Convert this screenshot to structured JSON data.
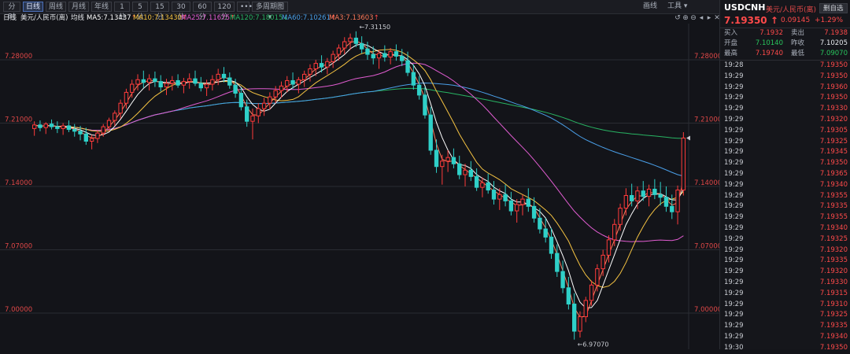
{
  "toolbar": {
    "tabs": [
      "分时",
      "日线",
      "周线",
      "月线",
      "年线",
      "1分",
      "5分",
      "15分",
      "30分",
      "60分",
      "120分",
      "•••",
      "多周期图"
    ],
    "active_index": 1,
    "right_items": [
      "画线",
      "工具"
    ],
    "panel_button": "删自选"
  },
  "ma_bar": {
    "period": "日线",
    "instrument": "美元/人民币(离)",
    "type": "均线",
    "items": [
      {
        "label": "MA5:7.13437",
        "arrow": "↑",
        "color": "#ffffff"
      },
      {
        "label": "MA10:7.13430",
        "arrow": "↑",
        "color": "#f5c342"
      },
      {
        "label": "MA25:7.11675",
        "arrow": "↑",
        "color": "#e05cd0"
      },
      {
        "label": "MA120:7.18015",
        "arrow": "↓",
        "color": "#28b463"
      },
      {
        "label": "MA60:7.10261",
        "arrow": "↑",
        "color": "#4a9fe8"
      },
      {
        "label": "MA3:7.13603",
        "arrow": "↑",
        "color": "#ff7c5c"
      }
    ]
  },
  "chart_data": {
    "type": "candlestick",
    "y_ticks": [
      "7.28000",
      "7.21000",
      "7.14000",
      "7.07000",
      "7.00000"
    ],
    "ylim": [
      6.96,
      7.32
    ],
    "annotations": [
      {
        "label": "←7.31150",
        "value": 7.3115
      },
      {
        "label": "←6.97070",
        "value": 6.9707
      }
    ],
    "current_price": 7.1935,
    "ohlc": [
      [
        7.204,
        7.212,
        7.196,
        7.208
      ],
      [
        7.208,
        7.213,
        7.201,
        7.205
      ],
      [
        7.205,
        7.211,
        7.198,
        7.209
      ],
      [
        7.209,
        7.214,
        7.203,
        7.206
      ],
      [
        7.206,
        7.212,
        7.199,
        7.204
      ],
      [
        7.204,
        7.21,
        7.197,
        7.207
      ],
      [
        7.207,
        7.213,
        7.2,
        7.203
      ],
      [
        7.203,
        7.209,
        7.195,
        7.201
      ],
      [
        7.201,
        7.207,
        7.191,
        7.198
      ],
      [
        7.198,
        7.205,
        7.186,
        7.19
      ],
      [
        7.19,
        7.197,
        7.181,
        7.193
      ],
      [
        7.193,
        7.202,
        7.188,
        7.199
      ],
      [
        7.199,
        7.209,
        7.195,
        7.206
      ],
      [
        7.206,
        7.216,
        7.201,
        7.213
      ],
      [
        7.213,
        7.224,
        7.207,
        7.221
      ],
      [
        7.221,
        7.236,
        7.215,
        7.232
      ],
      [
        7.232,
        7.248,
        7.226,
        7.244
      ],
      [
        7.244,
        7.258,
        7.238,
        7.253
      ],
      [
        7.253,
        7.264,
        7.246,
        7.258
      ],
      [
        7.258,
        7.268,
        7.249,
        7.255
      ],
      [
        7.255,
        7.264,
        7.246,
        7.259
      ],
      [
        7.259,
        7.267,
        7.25,
        7.256
      ],
      [
        7.256,
        7.263,
        7.245,
        7.25
      ],
      [
        7.25,
        7.259,
        7.241,
        7.254
      ],
      [
        7.254,
        7.262,
        7.246,
        7.257
      ],
      [
        7.257,
        7.264,
        7.249,
        7.252
      ],
      [
        7.252,
        7.26,
        7.243,
        7.256
      ],
      [
        7.256,
        7.265,
        7.248,
        7.259
      ],
      [
        7.259,
        7.268,
        7.251,
        7.254
      ],
      [
        7.254,
        7.261,
        7.245,
        7.249
      ],
      [
        7.249,
        7.258,
        7.24,
        7.253
      ],
      [
        7.253,
        7.263,
        7.246,
        7.258
      ],
      [
        7.258,
        7.27,
        7.252,
        7.264
      ],
      [
        7.264,
        7.272,
        7.255,
        7.26
      ],
      [
        7.26,
        7.266,
        7.248,
        7.252
      ],
      [
        7.252,
        7.259,
        7.238,
        7.243
      ],
      [
        7.243,
        7.249,
        7.224,
        7.228
      ],
      [
        7.228,
        7.236,
        7.206,
        7.212
      ],
      [
        7.212,
        7.226,
        7.192,
        7.218
      ],
      [
        7.218,
        7.232,
        7.21,
        7.226
      ],
      [
        7.226,
        7.238,
        7.218,
        7.232
      ],
      [
        7.232,
        7.244,
        7.225,
        7.239
      ],
      [
        7.239,
        7.251,
        7.232,
        7.246
      ],
      [
        7.246,
        7.256,
        7.238,
        7.251
      ],
      [
        7.251,
        7.262,
        7.244,
        7.257
      ],
      [
        7.257,
        7.266,
        7.248,
        7.253
      ],
      [
        7.253,
        7.261,
        7.243,
        7.258
      ],
      [
        7.258,
        7.268,
        7.25,
        7.264
      ],
      [
        7.264,
        7.275,
        7.256,
        7.27
      ],
      [
        7.27,
        7.28,
        7.262,
        7.276
      ],
      [
        7.276,
        7.285,
        7.266,
        7.272
      ],
      [
        7.272,
        7.282,
        7.264,
        7.278
      ],
      [
        7.278,
        7.29,
        7.271,
        7.286
      ],
      [
        7.286,
        7.297,
        7.279,
        7.293
      ],
      [
        7.293,
        7.305,
        7.286,
        7.3
      ],
      [
        7.3,
        7.309,
        7.291,
        7.304
      ],
      [
        7.304,
        7.3115,
        7.294,
        7.298
      ],
      [
        7.298,
        7.306,
        7.287,
        7.292
      ],
      [
        7.292,
        7.3,
        7.28,
        7.286
      ],
      [
        7.286,
        7.295,
        7.275,
        7.282
      ],
      [
        7.282,
        7.291,
        7.27,
        7.287
      ],
      [
        7.287,
        7.296,
        7.278,
        7.283
      ],
      [
        7.283,
        7.293,
        7.275,
        7.289
      ],
      [
        7.289,
        7.297,
        7.279,
        7.284
      ],
      [
        7.284,
        7.292,
        7.273,
        7.279
      ],
      [
        7.279,
        7.289,
        7.262,
        7.266
      ],
      [
        7.266,
        7.275,
        7.247,
        7.252
      ],
      [
        7.252,
        7.262,
        7.236,
        7.241
      ],
      [
        7.241,
        7.25,
        7.215,
        7.219
      ],
      [
        7.219,
        7.228,
        7.175,
        7.18
      ],
      [
        7.18,
        7.192,
        7.155,
        7.162
      ],
      [
        7.162,
        7.175,
        7.142,
        7.168
      ],
      [
        7.168,
        7.18,
        7.156,
        7.172
      ],
      [
        7.172,
        7.182,
        7.16,
        7.165
      ],
      [
        7.165,
        7.174,
        7.148,
        7.153
      ],
      [
        7.153,
        7.165,
        7.14,
        7.158
      ],
      [
        7.158,
        7.168,
        7.146,
        7.151
      ],
      [
        7.151,
        7.16,
        7.135,
        7.139
      ],
      [
        7.139,
        7.15,
        7.128,
        7.144
      ],
      [
        7.144,
        7.154,
        7.132,
        7.136
      ],
      [
        7.136,
        7.146,
        7.12,
        7.126
      ],
      [
        7.126,
        7.138,
        7.114,
        7.131
      ],
      [
        7.131,
        7.142,
        7.118,
        7.124
      ],
      [
        7.124,
        7.134,
        7.108,
        7.113
      ],
      [
        7.113,
        7.126,
        7.1,
        7.12
      ],
      [
        7.12,
        7.131,
        7.108,
        7.126
      ],
      [
        7.126,
        7.138,
        7.112,
        7.118
      ],
      [
        7.118,
        7.128,
        7.1,
        7.105
      ],
      [
        7.105,
        7.116,
        7.088,
        7.093
      ],
      [
        7.093,
        7.105,
        7.078,
        7.084
      ],
      [
        7.084,
        7.094,
        7.06,
        7.066
      ],
      [
        7.066,
        7.076,
        7.04,
        7.046
      ],
      [
        7.046,
        7.058,
        7.022,
        7.028
      ],
      [
        7.028,
        7.04,
        7.004,
        7.01
      ],
      [
        7.01,
        7.022,
        6.9707,
        6.98
      ],
      [
        6.98,
        7.002,
        6.973,
        6.996
      ],
      [
        6.996,
        7.018,
        6.99,
        7.014
      ],
      [
        7.014,
        7.036,
        7.008,
        7.031
      ],
      [
        7.031,
        7.054,
        7.024,
        7.049
      ],
      [
        7.049,
        7.07,
        7.041,
        7.064
      ],
      [
        7.064,
        7.086,
        7.056,
        7.081
      ],
      [
        7.081,
        7.104,
        7.074,
        7.098
      ],
      [
        7.098,
        7.121,
        7.091,
        7.116
      ],
      [
        7.116,
        7.138,
        7.108,
        7.13
      ],
      [
        7.13,
        7.143,
        7.118,
        7.124
      ],
      [
        7.124,
        7.14,
        7.115,
        7.135
      ],
      [
        7.135,
        7.146,
        7.124,
        7.129
      ],
      [
        7.129,
        7.142,
        7.118,
        7.137
      ],
      [
        7.137,
        7.148,
        7.126,
        7.131
      ],
      [
        7.131,
        7.145,
        7.119,
        7.128
      ],
      [
        7.128,
        7.14,
        7.112,
        7.118
      ],
      [
        7.118,
        7.131,
        7.104,
        7.112
      ],
      [
        7.112,
        7.141,
        7.098,
        7.136
      ],
      [
        7.136,
        7.2,
        7.13,
        7.1935
      ]
    ]
  },
  "panel": {
    "symbol": "USDCNH",
    "name": "美元/人民币(离)",
    "price": "7.19350",
    "arrow": "↑",
    "change": "0.09145",
    "change_pct": "+1.29%",
    "rows": [
      {
        "l1": "买入",
        "v1": "7.1932",
        "c1": "#ff4a4a",
        "l2": "卖出",
        "v2": "7.1938",
        "c2": "#ff4a4a"
      },
      {
        "l1": "开盘",
        "v1": "7.10140",
        "c1": "#28c35c",
        "l2": "昨收",
        "v2": "7.10205",
        "c2": "#e6e8ec"
      },
      {
        "l1": "最高",
        "v1": "7.19740",
        "c1": "#ff4a4a",
        "l2": "最低",
        "v2": "7.09070",
        "c2": "#28c35c"
      }
    ],
    "ticks": [
      {
        "t": "19:28",
        "p": "7.19350"
      },
      {
        "t": "19:29",
        "p": "7.19350"
      },
      {
        "t": "19:29",
        "p": "7.19360"
      },
      {
        "t": "19:29",
        "p": "7.19350"
      },
      {
        "t": "19:29",
        "p": "7.19330"
      },
      {
        "t": "19:29",
        "p": "7.19320"
      },
      {
        "t": "19:29",
        "p": "7.19305"
      },
      {
        "t": "19:29",
        "p": "7.19325"
      },
      {
        "t": "19:29",
        "p": "7.19345"
      },
      {
        "t": "19:29",
        "p": "7.19350"
      },
      {
        "t": "19:29",
        "p": "7.19365"
      },
      {
        "t": "19:29",
        "p": "7.19340"
      },
      {
        "t": "19:29",
        "p": "7.19355"
      },
      {
        "t": "19:29",
        "p": "7.19335"
      },
      {
        "t": "19:29",
        "p": "7.19355"
      },
      {
        "t": "19:29",
        "p": "7.19340"
      },
      {
        "t": "19:29",
        "p": "7.19325"
      },
      {
        "t": "19:29",
        "p": "7.19320"
      },
      {
        "t": "19:29",
        "p": "7.19335"
      },
      {
        "t": "19:29",
        "p": "7.19320"
      },
      {
        "t": "19:29",
        "p": "7.19330"
      },
      {
        "t": "19:29",
        "p": "7.19315"
      },
      {
        "t": "19:29",
        "p": "7.19310"
      },
      {
        "t": "19:29",
        "p": "7.19325"
      },
      {
        "t": "19:29",
        "p": "7.19335"
      },
      {
        "t": "19:29",
        "p": "7.19340"
      },
      {
        "t": "19:30",
        "p": "7.19350"
      }
    ]
  }
}
